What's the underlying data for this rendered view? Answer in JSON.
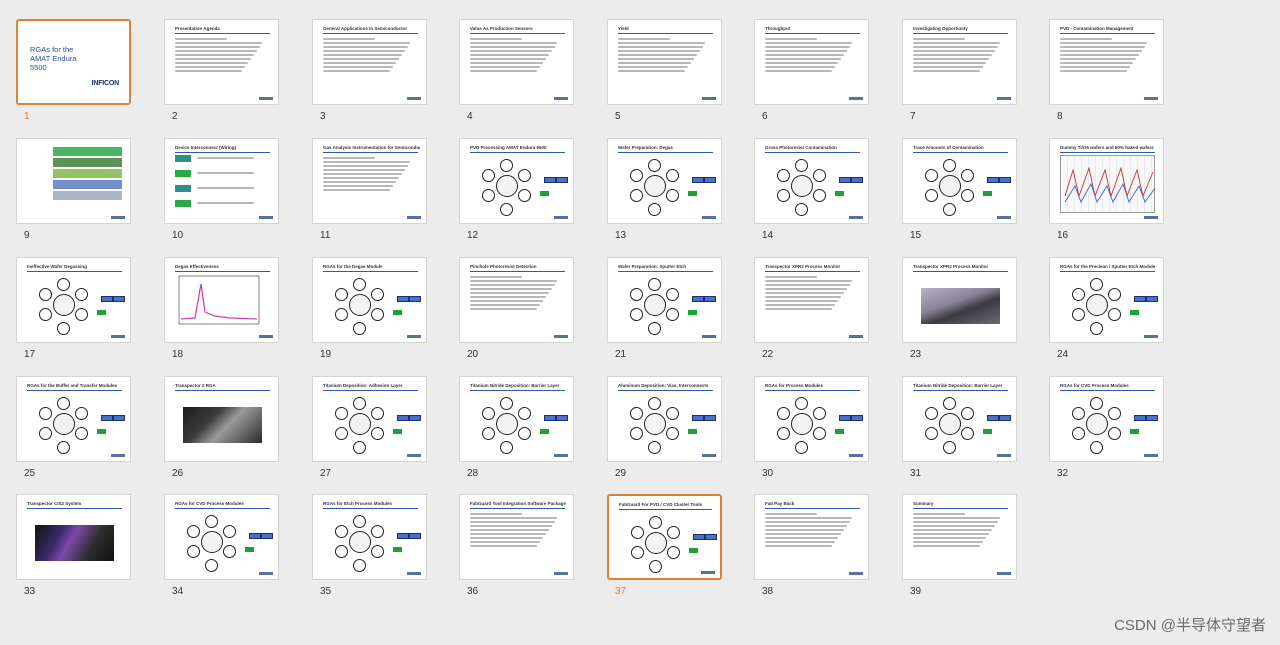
{
  "watermark": "CSDN @半导体守望者",
  "selected_slides": [
    1,
    37
  ],
  "slides": [
    {
      "n": "1",
      "title": "RGAs for the AMAT Endura 5500",
      "kind": "title",
      "logo": "INFICON"
    },
    {
      "n": "2",
      "title": "Presentation Agenda",
      "kind": "text"
    },
    {
      "n": "3",
      "title": "General Applications In Semiconductor",
      "kind": "text"
    },
    {
      "n": "4",
      "title": "Value As Production Sensors",
      "kind": "text"
    },
    {
      "n": "5",
      "title": "Yield",
      "kind": "text"
    },
    {
      "n": "6",
      "title": "Throughput",
      "kind": "text"
    },
    {
      "n": "7",
      "title": "Investigating Opportunity",
      "kind": "text"
    },
    {
      "n": "8",
      "title": "PVD - Contamination Management",
      "kind": "text"
    },
    {
      "n": "9",
      "title": "",
      "kind": "diagram-layers"
    },
    {
      "n": "10",
      "title": "Device Interconnect (Wiring)",
      "kind": "diagram-steps"
    },
    {
      "n": "11",
      "title": "Gas Analysis Instrumentation for Semiconductor Processes",
      "kind": "text"
    },
    {
      "n": "12",
      "title": "PVD Processing AMAT Endura 5500",
      "kind": "diagram"
    },
    {
      "n": "13",
      "title": "Wafer Preparation: Degas",
      "kind": "diagram"
    },
    {
      "n": "14",
      "title": "Gross Photoresist Contamination",
      "kind": "diagram"
    },
    {
      "n": "15",
      "title": "Trace Amounts of Contamination",
      "kind": "diagram"
    },
    {
      "n": "16",
      "title": "Dummy Ti/O5 wafers and 50% baked wafers",
      "kind": "screenshot"
    },
    {
      "n": "17",
      "title": "Ineffective Wafer Degassing",
      "kind": "diagram"
    },
    {
      "n": "18",
      "title": "Degas Effectiveness",
      "kind": "chart"
    },
    {
      "n": "19",
      "title": "RGAs for the Degas Module",
      "kind": "diagram"
    },
    {
      "n": "20",
      "title": "Pinchole Photoresist Detection",
      "kind": "text"
    },
    {
      "n": "21",
      "title": "Wafer Preparation: Sputter Etch",
      "kind": "diagram"
    },
    {
      "n": "22",
      "title": "Transpector XPR2 Process Monitor",
      "kind": "text"
    },
    {
      "n": "23",
      "title": "Transpector XPR2 Process Monitor",
      "kind": "photo"
    },
    {
      "n": "24",
      "title": "RGAs for the Preclean / Sputter Etch Module",
      "kind": "diagram"
    },
    {
      "n": "25",
      "title": "RGAs for the Buffer and Transfer Modules",
      "kind": "diagram"
    },
    {
      "n": "26",
      "title": "Transpector 2 RGA",
      "kind": "photo"
    },
    {
      "n": "27",
      "title": "Titanium Deposition: Adhesion Layer",
      "kind": "diagram"
    },
    {
      "n": "28",
      "title": "Titanium Nitride Deposition: Barrier Layer",
      "kind": "diagram"
    },
    {
      "n": "29",
      "title": "Aluminum Deposition: Vias, Interconnects",
      "kind": "diagram"
    },
    {
      "n": "30",
      "title": "RGAs for Process Modules",
      "kind": "diagram"
    },
    {
      "n": "31",
      "title": "Titanium Nitride Deposition: Barrier Layer",
      "kind": "diagram"
    },
    {
      "n": "32",
      "title": "RGAs for CVD Process Modules",
      "kind": "diagram"
    },
    {
      "n": "33",
      "title": "Transpector CIS2 System",
      "kind": "photo"
    },
    {
      "n": "34",
      "title": "RGAs for CVD Process Modules",
      "kind": "diagram"
    },
    {
      "n": "35",
      "title": "RGAs for Etch Process Modules",
      "kind": "diagram"
    },
    {
      "n": "36",
      "title": "FabGuard Tool Integration Software Package",
      "kind": "text"
    },
    {
      "n": "37",
      "title": "FabGuard For PVD / CVD Cluster Tools",
      "kind": "diagram"
    },
    {
      "n": "38",
      "title": "Fab Pay Back",
      "kind": "text"
    },
    {
      "n": "39",
      "title": "Summary",
      "kind": "text"
    }
  ]
}
